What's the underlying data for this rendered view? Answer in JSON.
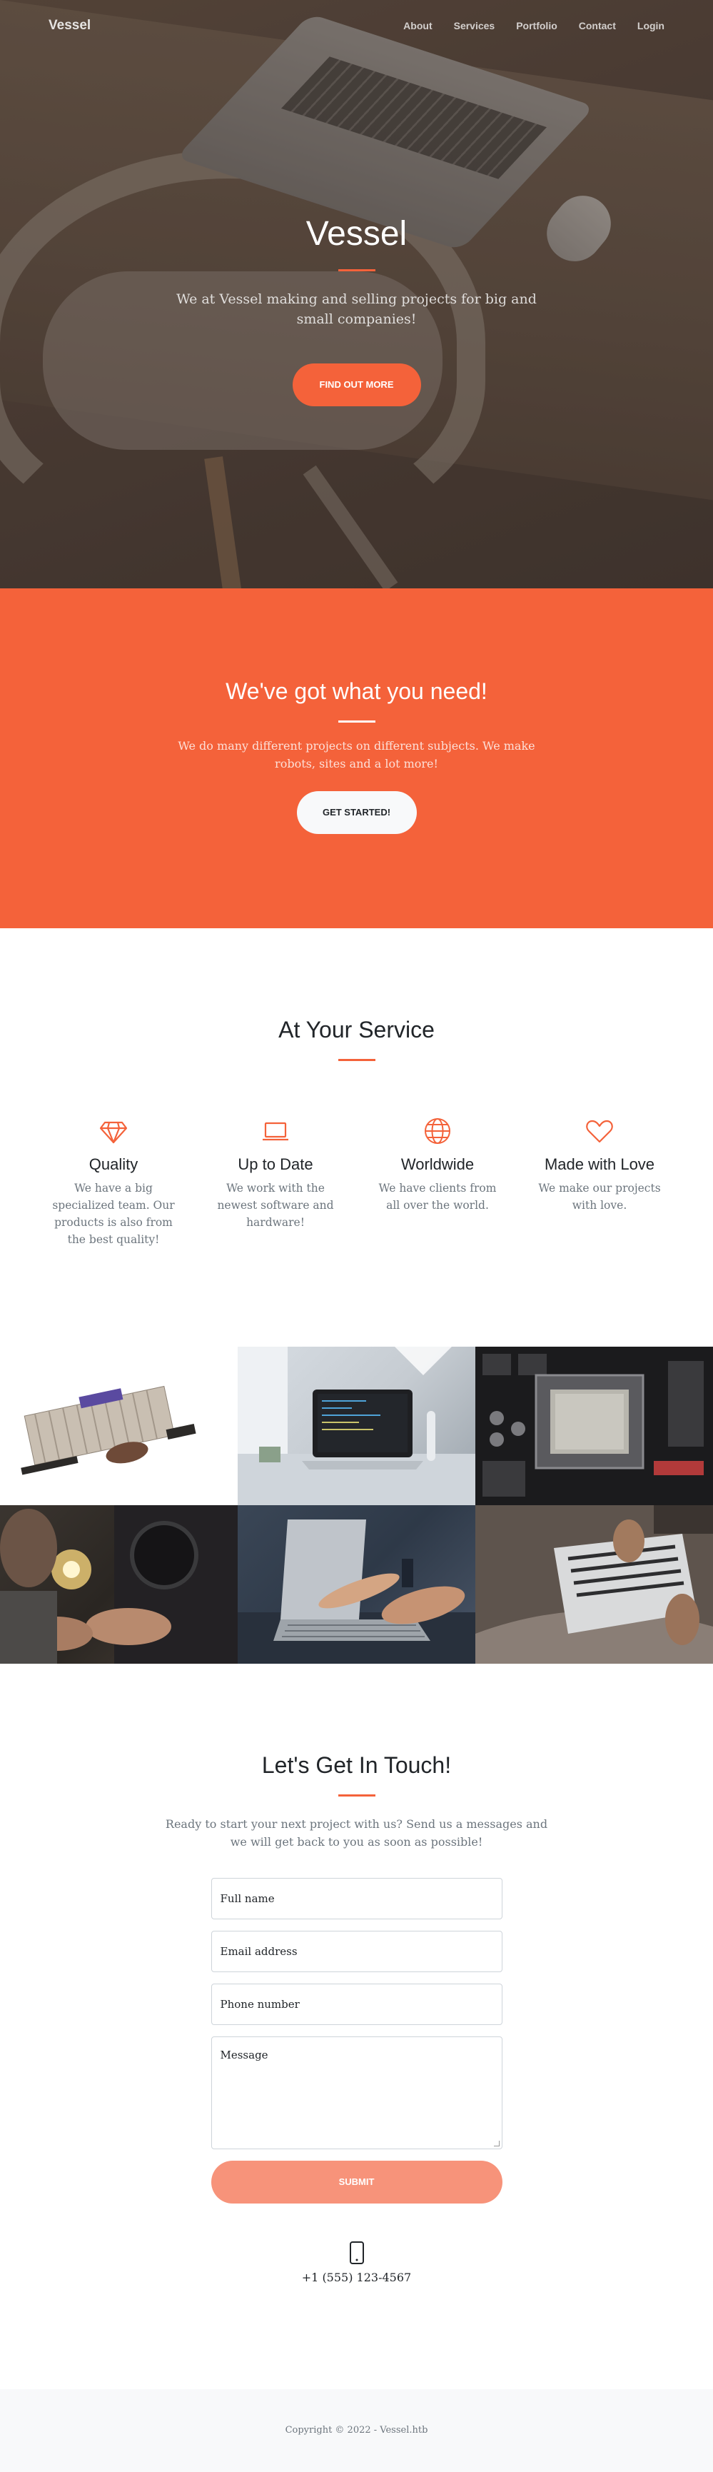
{
  "nav": {
    "brand": "Vessel",
    "links": [
      "About",
      "Services",
      "Portfolio",
      "Contact",
      "Login"
    ]
  },
  "hero": {
    "title": "Vessel",
    "text": "We at Vessel making and selling projects for big and small companies!",
    "button": "Find Out More"
  },
  "need": {
    "title": "We've got what you need!",
    "text": "We do many different projects on different subjects. We make robots, sites and a lot more!",
    "button": "Get Started!"
  },
  "services": {
    "title": "At Your Service",
    "items": [
      {
        "icon": "gem-icon",
        "title": "Quality",
        "text": "We have a big specialized team. Our products is also from the best quality!"
      },
      {
        "icon": "laptop-icon",
        "title": "Up to Date",
        "text": "We work with the newest software and hardware!"
      },
      {
        "icon": "globe-icon",
        "title": "Worldwide",
        "text": "We have clients from all over the world."
      },
      {
        "icon": "heart-icon",
        "title": "Made with Love",
        "text": "We make our projects with love."
      }
    ]
  },
  "contact": {
    "title": "Let's Get In Touch!",
    "text": "Ready to start your next project with us? Send us a messages and we will get back to you as soon as possible!",
    "fields": {
      "name": "Full name",
      "email": "Email address",
      "phone": "Phone number",
      "message": "Message"
    },
    "submit": "Submit",
    "phone_icon": "phone-icon",
    "phone": "+1 (555) 123-4567"
  },
  "footer": {
    "copyright": "Copyright © 2022 - Vessel.htb"
  },
  "colors": {
    "accent": "#f4623a",
    "submit_disabled": "#f7937a",
    "footer_bg": "#f8f9fa"
  }
}
